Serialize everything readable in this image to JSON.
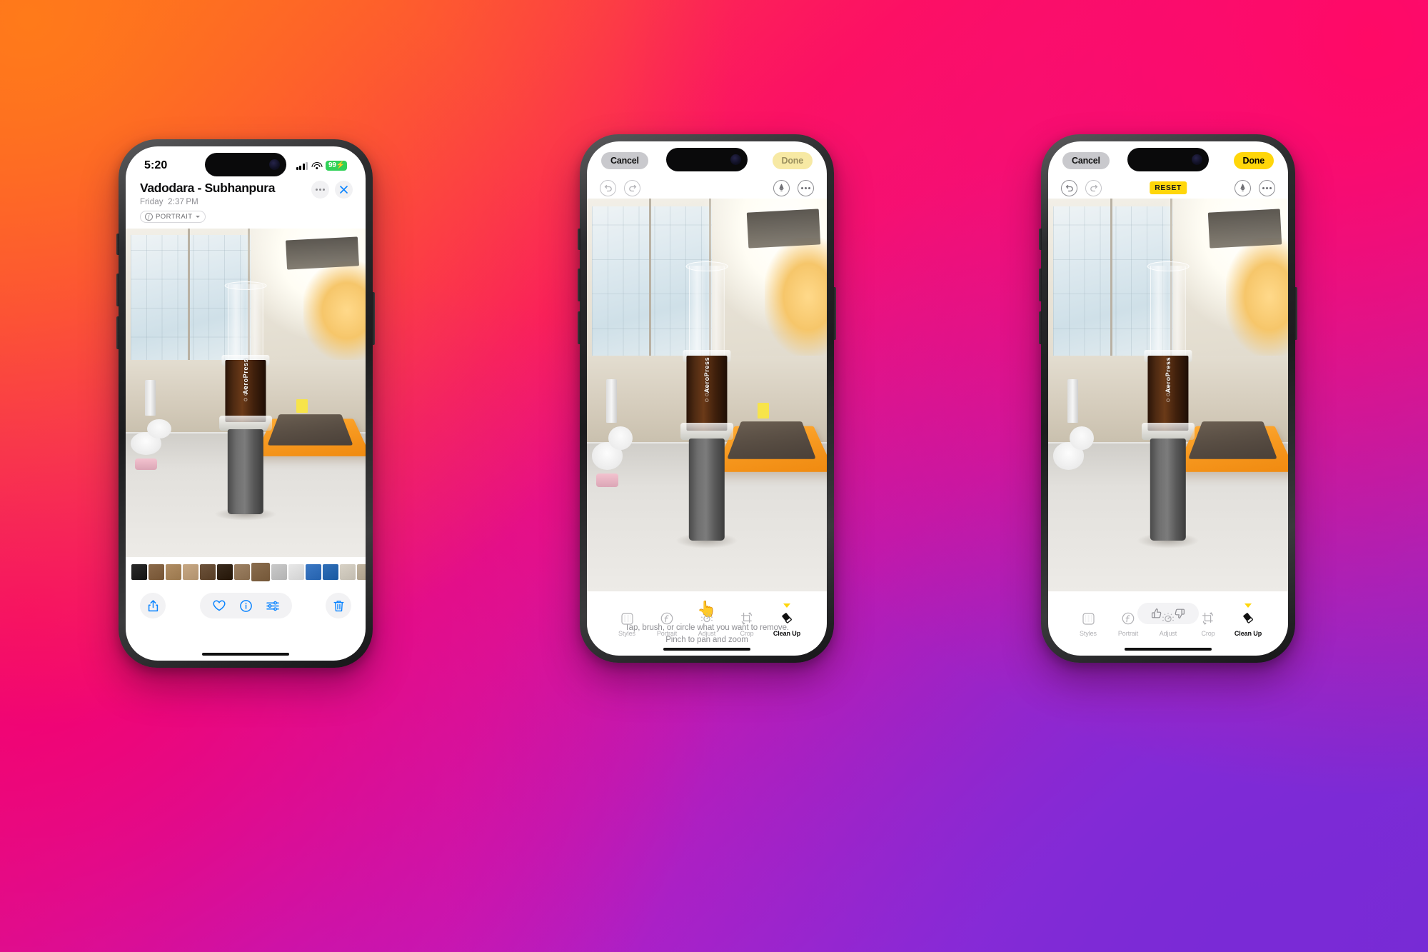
{
  "meta": {
    "scene": "Three iPhone mockups showing Apple Photos viewer and Clean Up editing tool",
    "background_colors": [
      "#ff6a1f",
      "#fa1364",
      "#e0119b",
      "#9b2ad8",
      "#6a2fd0"
    ]
  },
  "status_bar": {
    "time": "5:20",
    "battery_level": "99",
    "battery_charging_glyph": "⚡",
    "battery_color": "#30d158",
    "signal_icon": "cellular-signal-icon",
    "wifi_icon": "wifi-icon"
  },
  "phone1": {
    "title": "Vadodara - Subhanpura",
    "day": "Friday",
    "time": "2:37 PM",
    "badge_label": "PORTRAIT",
    "badge_icon": "aperture-icon",
    "badge_chevron": "chevron-down-icon",
    "more_button": "more-options-icon",
    "close_button": "close-icon",
    "toolbar": {
      "share": "share-icon",
      "favorite": "heart-icon",
      "info": "info-icon",
      "adjust": "adjustments-icon",
      "delete": "trash-icon"
    },
    "filmstrip_colors": [
      "#2a2a2a",
      "#8b6a4a",
      "#b08d63",
      "#c7a884",
      "#6d533b",
      "#3a2b1d",
      "#9d8163",
      "#8a6d4e",
      "#c9c9c9",
      "#e8e8e8",
      "#3b78c4",
      "#2f6fb8",
      "#d8d2c6",
      "#c0b49f",
      "#f2e7d2",
      "#1a1a1a",
      "#4a4a4a",
      "#d9d9d9"
    ]
  },
  "phone2": {
    "cancel_label": "Cancel",
    "done_label": "Done",
    "done_enabled": false,
    "undo_icon": "undo-icon",
    "redo_icon": "redo-icon",
    "markup_icon": "markup-pen-icon",
    "more_icon": "more-options-icon",
    "hint_icon": "tap-hand-icon",
    "hint_line1": "Tap, brush, or circle what you want to remove.",
    "hint_line2": "Pinch to pan and zoom",
    "tabs": [
      {
        "label": "Styles",
        "icon": "styles-grid-icon",
        "active": false
      },
      {
        "label": "Portrait",
        "icon": "portrait-f-icon",
        "active": false
      },
      {
        "label": "Adjust",
        "icon": "adjust-dial-icon",
        "active": false
      },
      {
        "label": "Crop",
        "icon": "crop-rotate-icon",
        "active": false
      },
      {
        "label": "Clean Up",
        "icon": "clean-up-eraser-icon",
        "active": true
      }
    ]
  },
  "phone3": {
    "cancel_label": "Cancel",
    "done_label": "Done",
    "done_enabled": true,
    "reset_label": "RESET",
    "reset_color": "#ffd60a",
    "undo_icon": "undo-icon",
    "redo_icon": "redo-icon",
    "markup_icon": "markup-pen-icon",
    "more_icon": "more-options-icon",
    "thumbs_up_icon": "thumbs-up-icon",
    "thumbs_down_icon": "thumbs-down-icon",
    "tabs": [
      {
        "label": "Styles",
        "icon": "styles-grid-icon",
        "active": false
      },
      {
        "label": "Portrait",
        "icon": "portrait-f-icon",
        "active": false
      },
      {
        "label": "Adjust",
        "icon": "adjust-dial-icon",
        "active": false
      },
      {
        "label": "Crop",
        "icon": "crop-rotate-icon",
        "active": false
      },
      {
        "label": "Clean Up",
        "icon": "clean-up-eraser-icon",
        "active": true
      }
    ]
  },
  "photo": {
    "subject_label": "AeroPress"
  }
}
